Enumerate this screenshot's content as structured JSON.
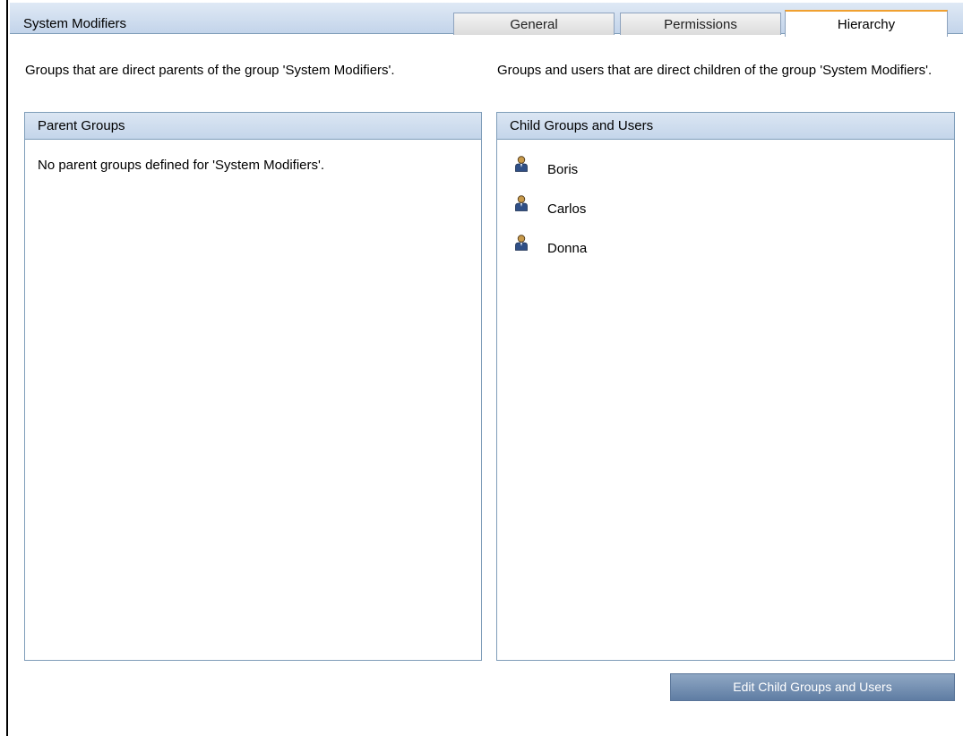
{
  "header": {
    "title": "System Modifiers"
  },
  "tabs": [
    {
      "label": "General",
      "active": false
    },
    {
      "label": "Permissions",
      "active": false
    },
    {
      "label": "Hierarchy",
      "active": true
    }
  ],
  "parents": {
    "description": "Groups that are direct parents of the group 'System Modifiers'.",
    "panel_title": "Parent Groups",
    "empty_message": "No parent groups defined for 'System Modifiers'."
  },
  "children": {
    "description": "Groups and users that are direct children of the group 'System Modifiers'.",
    "panel_title": "Child Groups and Users",
    "users": [
      {
        "name": "Boris",
        "icon": "user-icon"
      },
      {
        "name": "Carlos",
        "icon": "user-icon"
      },
      {
        "name": "Donna",
        "icon": "user-icon"
      }
    ],
    "edit_button_label": "Edit Child Groups and Users"
  },
  "colors": {
    "header_bg": "#c3d4ea",
    "active_tab_accent": "#f0a030",
    "button_bg": "#5f7da3",
    "user_icon_body": "#2f4f86",
    "user_icon_head": "#c89a4a"
  }
}
